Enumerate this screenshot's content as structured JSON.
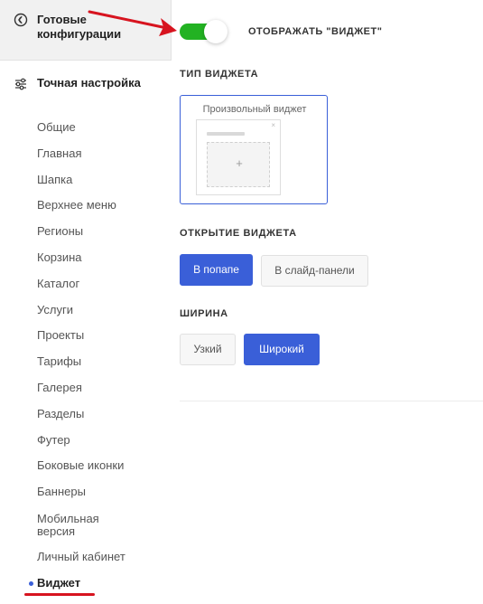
{
  "sidebar": {
    "presets_title": "Готовые конфигурации",
    "fine_title": "Точная настройка",
    "items": [
      {
        "label": "Общие"
      },
      {
        "label": "Главная"
      },
      {
        "label": "Шапка"
      },
      {
        "label": "Верхнее меню"
      },
      {
        "label": "Регионы"
      },
      {
        "label": "Корзина"
      },
      {
        "label": "Каталог"
      },
      {
        "label": "Услуги"
      },
      {
        "label": "Проекты"
      },
      {
        "label": "Тарифы"
      },
      {
        "label": "Галерея"
      },
      {
        "label": "Разделы"
      },
      {
        "label": "Футер"
      },
      {
        "label": "Боковые иконки"
      },
      {
        "label": "Баннеры"
      },
      {
        "label": "Мобильная версия"
      },
      {
        "label": "Личный кабинет"
      },
      {
        "label": "Виджет",
        "active": true
      }
    ]
  },
  "main": {
    "toggle_label": "ОТОБРАЖАТЬ \"ВИДЖЕТ\"",
    "toggle_on": true,
    "widget_type": {
      "title": "ТИП ВИДЖЕТА",
      "card_label": "Произвольный виджет",
      "close_glyph": "×",
      "plus_glyph": "+"
    },
    "widget_open": {
      "title": "ОТКРЫТИЕ ВИДЖЕТА",
      "options": [
        {
          "label": "В попапе",
          "selected": true
        },
        {
          "label": "В слайд-панели",
          "selected": false
        }
      ]
    },
    "width": {
      "title": "ШИРИНА",
      "options": [
        {
          "label": "Узкий",
          "selected": false
        },
        {
          "label": "Широкий",
          "selected": true
        }
      ]
    }
  },
  "colors": {
    "accent": "#3a5fd8",
    "toggle_on": "#22b222",
    "annotation_red": "#d7141f"
  }
}
